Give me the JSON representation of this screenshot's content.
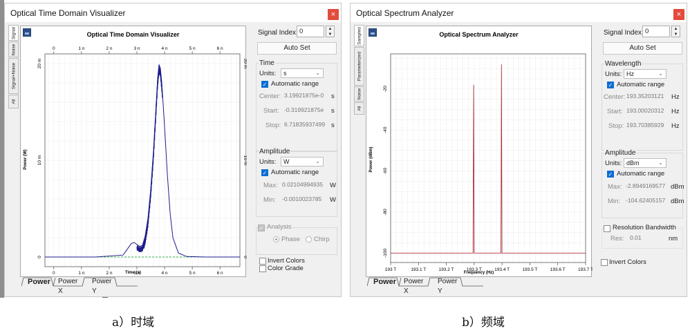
{
  "windows": [
    {
      "title": "Optical Time Domain Visualizer",
      "close": "×",
      "side_tabs": [
        "Signal",
        "Noise",
        "Signal+Noise",
        "All"
      ],
      "plot_title": "Optical Time Domain Visualizer",
      "ylabel": "Power (W)",
      "xlabel": "Time (s)",
      "x_ticks": [
        "0",
        "1 n",
        "2 n",
        "3 n",
        "4 n",
        "5 n",
        "6 n"
      ],
      "y_ticks": [
        "0",
        "10 m",
        "20 m"
      ],
      "bottom_tabs": [
        "Power",
        "Power X",
        "Power Y"
      ],
      "signal_index_label": "Signal Index:",
      "signal_index": "0",
      "autoset": "Auto Set",
      "axis_group": "Time",
      "units_label": "Units:",
      "units": "s",
      "auto_range": "Automatic range",
      "center_label": "Center:",
      "center": "3.19921875e-0",
      "center_unit": "s",
      "start_label": "Start:",
      "start": "-0.319921875e",
      "start_unit": "s",
      "stop_label": "Stop:",
      "stop": "6.71835937499",
      "stop_unit": "s",
      "amp_group": "Amplitude",
      "amp_units": "W",
      "max_label": "Max:",
      "max": "0.02104994935",
      "max_unit": "W",
      "min_label": "Min:",
      "min": "-0.0010023785",
      "min_unit": "W",
      "analysis": "Analysis",
      "phase": "Phase",
      "chirp": "Chirp",
      "invert_colors": "Invert Colors",
      "color_grade": "Color Grade"
    },
    {
      "title": "Optical Spectrum Analyzer",
      "close": "×",
      "side_tabs": [
        "Sampled",
        "Parameterized",
        "Noise",
        "All"
      ],
      "plot_title": "Optical Spectrum Analyzer",
      "ylabel": "Power (dBm)",
      "xlabel": "Frequency (Hz)",
      "x_ticks": [
        "193 T",
        "193.1 T",
        "193.2 T",
        "193.3 T",
        "193.4 T",
        "193.5 T",
        "193.6 T",
        "193.7 T"
      ],
      "y_ticks": [
        "-20",
        "-40",
        "-60",
        "-80",
        "-100"
      ],
      "bottom_tabs": [
        "Power",
        "Power X",
        "Power Y"
      ],
      "signal_index_label": "Signal Index:",
      "signal_index": "0",
      "autoset": "Auto Set",
      "axis_group": "Wavelength",
      "units_label": "Units:",
      "units": "Hz",
      "auto_range": "Automatic range",
      "center_label": "Center:",
      "center": "193.35203121",
      "center_unit": "Hz",
      "start_label": "Start:",
      "start": "193.00020312",
      "start_unit": "Hz",
      "stop_label": "Stop:",
      "stop": "193.70385929",
      "stop_unit": "Hz",
      "amp_group": "Amplitude",
      "amp_units": "dBm",
      "max_label": "Max:",
      "max": "-2.8949169577",
      "max_unit": "dBm",
      "min_label": "Min:",
      "min": "-104.62405157",
      "min_unit": "dBm",
      "res_bw": "Resolution Bandwidth",
      "res_label": "Res:",
      "res": "0.01",
      "res_unit": "nm",
      "invert_colors": "Invert Colors"
    }
  ],
  "captions": [
    "a）时域",
    "b）频域"
  ],
  "colors": {
    "time_trace": "#1c1c8c",
    "time_baseline": "#3aa84a",
    "spectrum_trace": "#b0303a",
    "grid": "#d7d7d7"
  },
  "chart_data": [
    {
      "type": "line",
      "title": "Optical Time Domain Visualizer",
      "xlabel": "Time (s)",
      "ylabel": "Power (W)",
      "xlim": [
        -0.32,
        6.72
      ],
      "ylim": [
        -0.001,
        0.021
      ],
      "x_ticks": [
        "0",
        "1 n",
        "2 n",
        "3 n",
        "4 n",
        "5 n",
        "6 n"
      ],
      "y_ticks": [
        "0",
        "10 m",
        "20 m"
      ],
      "grid": true,
      "series": [
        {
          "x": [
            -0.32,
            0.5,
            1.5,
            2.5,
            2.65,
            2.8,
            2.9,
            3.0,
            3.1,
            3.2,
            3.3,
            3.4,
            3.5,
            3.6,
            3.7,
            3.75,
            3.8,
            3.85,
            3.9,
            4.0,
            4.1,
            4.2,
            4.3,
            4.5,
            4.8,
            5.5,
            6.72
          ],
          "y": [
            0,
            0,
            0,
            0.0002,
            0.0008,
            0.0014,
            0.0015,
            0.0013,
            0.0011,
            0.0012,
            0.0022,
            0.004,
            0.007,
            0.011,
            0.016,
            0.0185,
            0.0199,
            0.0195,
            0.018,
            0.0135,
            0.0085,
            0.0045,
            0.002,
            0.0004,
            5e-05,
            0,
            0
          ]
        }
      ]
    },
    {
      "type": "line",
      "title": "Optical Spectrum Analyzer",
      "xlabel": "Frequency (Hz)",
      "ylabel": "Power (dBm)",
      "xlim": [
        193.0,
        193.7
      ],
      "ylim": [
        -104.6,
        -2.9
      ],
      "x_ticks": [
        "193 T",
        "193.1 T",
        "193.2 T",
        "193.3 T",
        "193.4 T",
        "193.5 T",
        "193.6 T",
        "193.7 T"
      ],
      "y_ticks": [
        "-20",
        "-40",
        "-60",
        "-80",
        "-100"
      ],
      "grid": true,
      "series": [
        {
          "x": [
            193.0,
            193.29,
            193.296,
            193.297,
            193.298,
            193.299,
            193.3,
            193.305,
            193.39,
            193.396,
            193.397,
            193.398,
            193.399,
            193.4,
            193.405,
            193.7
          ],
          "y": [
            -100,
            -100,
            -100,
            -60,
            -18,
            -60,
            -100,
            -100,
            -100,
            -100,
            -60,
            -8,
            -60,
            -100,
            -100,
            -100
          ]
        }
      ]
    }
  ]
}
